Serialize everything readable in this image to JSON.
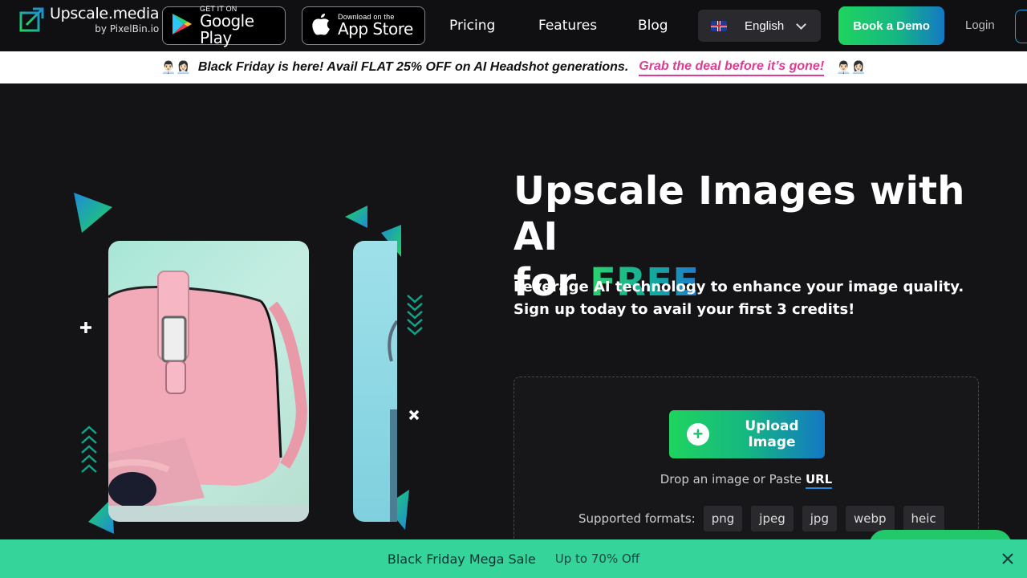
{
  "header": {
    "logo_title": "Upscale.media",
    "logo_sub": "by PixelBin.io",
    "google_play": {
      "small": "GET IT ON",
      "big": "Google Play"
    },
    "app_store": {
      "small": "Download on the",
      "big": "App Store"
    },
    "nav": [
      "Pricing",
      "Features",
      "Blog"
    ],
    "language": "English",
    "book_demo": "Book a Demo",
    "login": "Login"
  },
  "promo": {
    "text": "Black Friday is here! Avail FLAT 25% OFF on AI Headshot generations.",
    "link": "Grab the deal before it’s gone!",
    "emoji": "👨🏻‍💼👩🏻‍💼"
  },
  "hero": {
    "title_line1": "Upscale Images with AI",
    "title_for": "for",
    "title_free": "FREE",
    "subtitle": "Leverage AI technology to enhance your image quality. Sign up today to avail your first 3 credits!"
  },
  "upload": {
    "button": "Upload Image",
    "drop_text": "Drop an image or Paste",
    "url": "URL",
    "formats_label": "Supported formats:",
    "formats": [
      "png",
      "jpeg",
      "jpg",
      "webp",
      "heic"
    ]
  },
  "bottom_bar": {
    "title": "Black Friday Mega Sale",
    "subtitle": "Up to 70% Off"
  },
  "colors": {
    "accent_green": "#1fd45f",
    "accent_blue": "#1378c4",
    "promo_link": "#e03a93",
    "bottom_bar": "#34d49a"
  }
}
